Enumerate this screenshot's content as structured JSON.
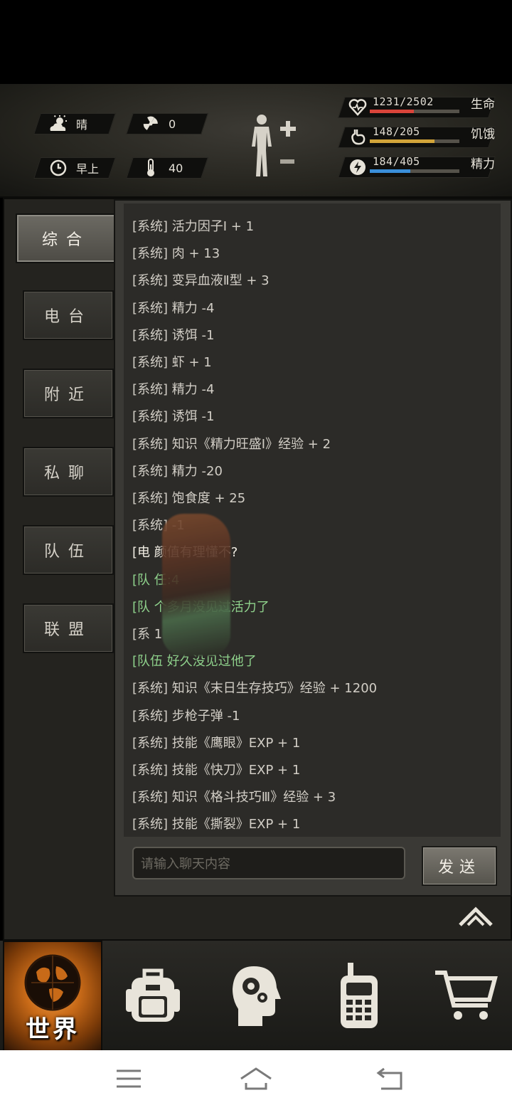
{
  "hud": {
    "weather": "晴",
    "radiation": "0",
    "time_of_day": "早上",
    "temperature": "40",
    "stats": [
      {
        "label": "生命",
        "value": "1231/2502",
        "fraction": 0.49,
        "color": "#d9443a",
        "icon": "heart-icon"
      },
      {
        "label": "饥饿",
        "value": "148/205",
        "fraction": 0.72,
        "color": "#d2a43a",
        "icon": "stomach-icon"
      },
      {
        "label": "精力",
        "value": "184/405",
        "fraction": 0.45,
        "color": "#3a8ed9",
        "icon": "energy-icon"
      }
    ]
  },
  "tabs": [
    {
      "label": "综合",
      "active": true
    },
    {
      "label": "电台",
      "active": false
    },
    {
      "label": "附近",
      "active": false
    },
    {
      "label": "私聊",
      "active": false
    },
    {
      "label": "队伍",
      "active": false
    },
    {
      "label": "联盟",
      "active": false
    }
  ],
  "messages": [
    {
      "channel": "[系统]",
      "text": "活力因子Ⅰ + 1",
      "type": "system"
    },
    {
      "channel": "[系统]",
      "text": "肉 + 13",
      "type": "system"
    },
    {
      "channel": "[系统]",
      "text": "变异血液Ⅱ型 + 3",
      "type": "system"
    },
    {
      "channel": "[系统]",
      "text": "精力 -4",
      "type": "system"
    },
    {
      "channel": "[系统]",
      "text": "诱饵 -1",
      "type": "system"
    },
    {
      "channel": "[系统]",
      "text": "虾 + 1",
      "type": "system"
    },
    {
      "channel": "[系统]",
      "text": "精力 -4",
      "type": "system"
    },
    {
      "channel": "[系统]",
      "text": "诱饵 -1",
      "type": "system"
    },
    {
      "channel": "[系统]",
      "text": "知识《精力旺盛Ⅰ》经验 + 2",
      "type": "system"
    },
    {
      "channel": "[系统]",
      "text": "精力 -20",
      "type": "system"
    },
    {
      "channel": "[系统]",
      "text": "饱食度 + 25",
      "type": "system"
    },
    {
      "channel": "[系统]",
      "text": "        -1",
      "type": "system"
    },
    {
      "channel": "[电",
      "text": "          颜值有理懂不?",
      "type": "radio"
    },
    {
      "channel": "[队",
      "text": "          任:4",
      "type": "team"
    },
    {
      "channel": "[队",
      "text": "       个多月没见过活力了",
      "type": "team"
    },
    {
      "channel": "[系",
      "text": "          1",
      "type": "system"
    },
    {
      "channel": "[队伍",
      "text": "      好久没见过他了",
      "type": "team"
    },
    {
      "channel": "[系统]",
      "text": "知识《末日生存技巧》经验 + 1200",
      "type": "system"
    },
    {
      "channel": "[系统]",
      "text": "步枪子弹 -1",
      "type": "system"
    },
    {
      "channel": "[系统]",
      "text": "技能《鹰眼》EXP + 1",
      "type": "system"
    },
    {
      "channel": "[系统]",
      "text": "技能《快刀》EXP + 1",
      "type": "system"
    },
    {
      "channel": "[系统]",
      "text": "知识《格斗技巧Ⅲ》经验 + 3",
      "type": "system"
    },
    {
      "channel": "[系统]",
      "text": "技能《撕裂》EXP + 1",
      "type": "system"
    }
  ],
  "input": {
    "placeholder": "请输入聊天内容",
    "send_label": "发送"
  },
  "bottom_nav": {
    "world_label": "世界",
    "items": [
      {
        "icon": "backpack-icon"
      },
      {
        "icon": "skills-head-icon"
      },
      {
        "icon": "walkie-talkie-icon"
      },
      {
        "icon": "shop-cart-icon"
      }
    ]
  },
  "system_nav": {
    "icons": [
      "menu-icon",
      "home-icon",
      "back-icon"
    ]
  }
}
